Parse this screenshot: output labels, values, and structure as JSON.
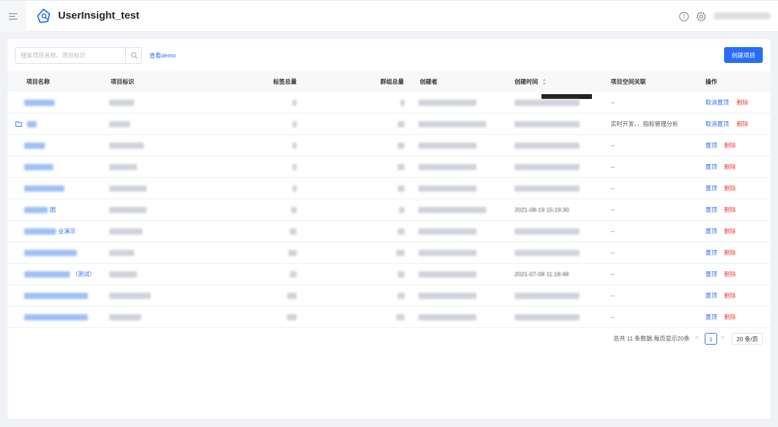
{
  "header": {
    "app_title": "UserInsight_test"
  },
  "toolbar": {
    "search_placeholder": "搜索项目名称、项目标识",
    "demo_link": "查看demo",
    "create_button": "创建项目"
  },
  "table": {
    "columns": [
      "项目名称",
      "项目标识",
      "标签总量",
      "群组总量",
      "创建者",
      "创建时间",
      "项目空间关联",
      "操作"
    ],
    "rows": [
      {
        "name_suffix": "",
        "space": "--",
        "pin": "取消置顶",
        "del": "删除",
        "folder": false,
        "time_text": ""
      },
      {
        "name_suffix": "",
        "space": "实时开发、、指标管理分析",
        "pin": "取消置顶",
        "del": "删除",
        "folder": true,
        "time_text": ""
      },
      {
        "name_suffix": "",
        "space": "--",
        "pin": "置顶",
        "del": "删除",
        "folder": false,
        "time_text": ""
      },
      {
        "name_suffix": "",
        "space": "--",
        "pin": "置顶",
        "del": "删除",
        "folder": false,
        "time_text": ""
      },
      {
        "name_suffix": "",
        "space": "--",
        "pin": "置顶",
        "del": "删除",
        "folder": false,
        "time_text": ""
      },
      {
        "name_suffix": "团",
        "space": "--",
        "pin": "置顶",
        "del": "删除",
        "folder": false,
        "time_text": "2021-08-19 15:19:30"
      },
      {
        "name_suffix": "业演示",
        "space": "--",
        "pin": "置顶",
        "del": "删除",
        "folder": false,
        "time_text": ""
      },
      {
        "name_suffix": "",
        "space": "--",
        "pin": "置顶",
        "del": "删除",
        "folder": false,
        "time_text": ""
      },
      {
        "name_suffix": "（测试）",
        "space": "--",
        "pin": "置顶",
        "del": "删除",
        "folder": false,
        "time_text": "2021-07-08 11:18:48"
      },
      {
        "name_suffix": "",
        "space": "--",
        "pin": "置顶",
        "del": "删除",
        "folder": false,
        "time_text": ""
      },
      {
        "name_suffix": "",
        "space": "--",
        "pin": "置顶",
        "del": "删除",
        "folder": false,
        "time_text": ""
      }
    ]
  },
  "pagination": {
    "total_text": "总共 11 条数据,每页显示20条",
    "current_page": "1",
    "page_size": "20 条/页",
    "prev": "<",
    "next": ">"
  },
  "colors": {
    "accent": "#2a6df5",
    "danger": "#f23d3d"
  },
  "icons": [
    "menu-icon",
    "logo-icon",
    "help-icon",
    "settings-icon",
    "search-icon",
    "folder-icon",
    "sort-icon"
  ]
}
